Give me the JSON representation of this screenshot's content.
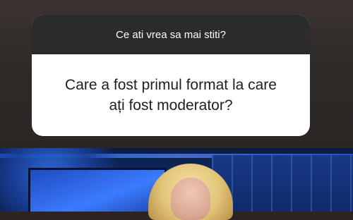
{
  "question_sticker": {
    "prompt": "Ce ati vrea sa mai stiti?",
    "answer_lines": [
      "Care a fost primul format la care",
      "ați fost moderator?"
    ]
  },
  "colors": {
    "header_bg": "#2b2b2b",
    "card_bg": "#ffffff",
    "answer_text": "#1f1f1f",
    "header_text": "#ffffff"
  }
}
